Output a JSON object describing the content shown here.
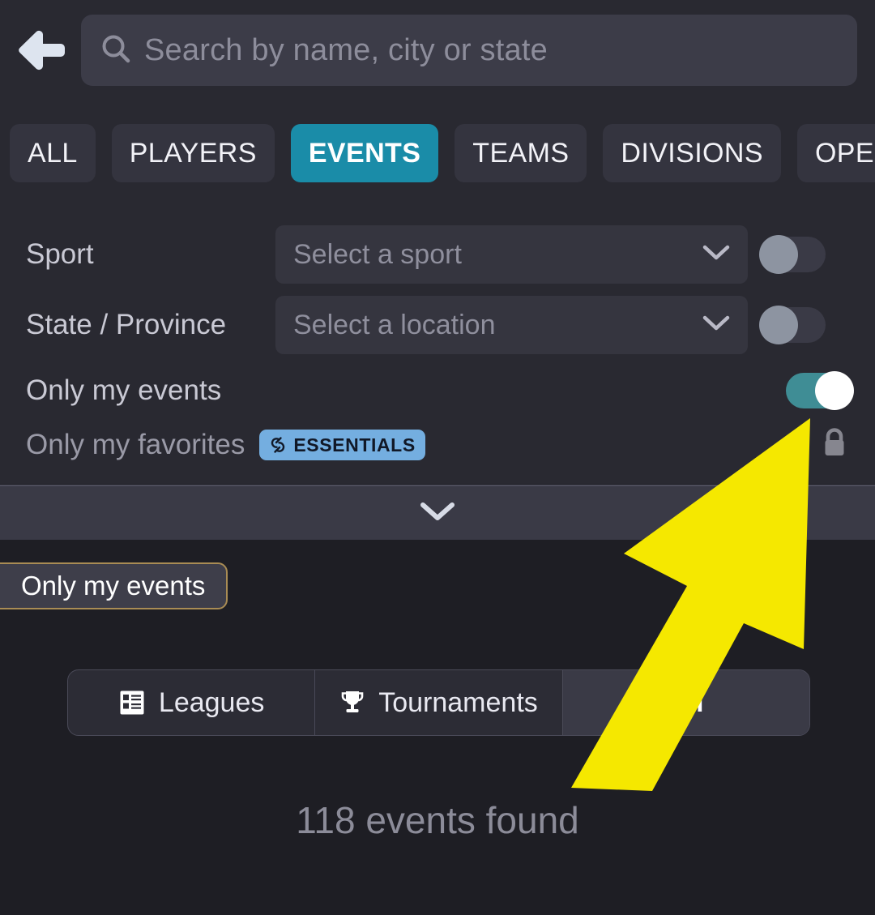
{
  "header": {
    "back_icon": "arrow-left-icon",
    "search": {
      "icon": "search-icon",
      "value": "",
      "placeholder": "Search by name, city or state"
    }
  },
  "tabs": {
    "items": [
      {
        "label": "ALL",
        "active": false
      },
      {
        "label": "PLAYERS",
        "active": false
      },
      {
        "label": "EVENTS",
        "active": true
      },
      {
        "label": "TEAMS",
        "active": false
      },
      {
        "label": "DIVISIONS",
        "active": false
      },
      {
        "label": "OPERATORS",
        "active": false
      }
    ],
    "active_label": "EVENTS",
    "active_color": "#1a8ca8"
  },
  "filters": {
    "sport": {
      "label": "Sport",
      "select_value": "",
      "select_placeholder": "Select a sport",
      "chevron_icon": "chevron-down-icon",
      "toggle_state": "off"
    },
    "state_province": {
      "label": "State / Province",
      "select_value": "",
      "select_placeholder": "Select a location",
      "chevron_icon": "chevron-down-icon",
      "toggle_state": "off"
    },
    "only_my_events": {
      "label": "Only my events",
      "toggle_state": "on",
      "toggle_color": "#3f8d95"
    },
    "only_my_favorites": {
      "label": "Only my favorites",
      "badge_label": "ESSENTIALS",
      "badge_icon": "essentials-logo-icon",
      "badge_color": "#74aee0",
      "lock_icon": "lock-icon",
      "locked": true
    },
    "expand_icon": "chevron-down-icon"
  },
  "active_filter_chips": [
    {
      "label": "Only my events",
      "border_color": "#a98c54"
    }
  ],
  "event_type_segments": {
    "items": [
      {
        "label": "Leagues",
        "icon": "standings-list-icon",
        "active": false
      },
      {
        "label": "Tournaments",
        "icon": "trophy-icon",
        "active": false
      },
      {
        "label": "All",
        "icon": "",
        "active": true
      }
    ]
  },
  "results": {
    "text": "118 events found",
    "count": 118
  },
  "annotation": {
    "arrow_color": "#f5e800",
    "points_at": "only-my-events-toggle"
  }
}
